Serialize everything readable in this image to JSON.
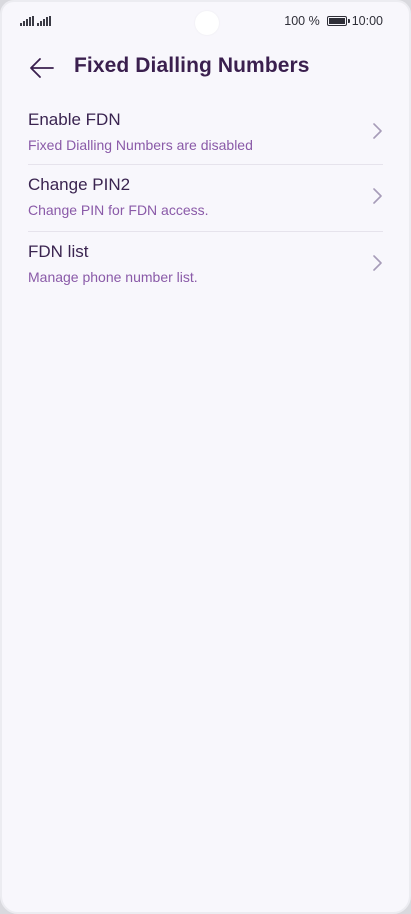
{
  "status_bar": {
    "battery_percent": "100 %",
    "time": "10:00"
  },
  "header": {
    "title": "Fixed Dialling Numbers"
  },
  "items": [
    {
      "title": "Enable FDN",
      "subtitle": "Fixed Dialling Numbers are disabled"
    },
    {
      "title": "Change PIN2",
      "subtitle": "Change PIN for FDN access."
    },
    {
      "title": "FDN list",
      "subtitle": "Manage phone number list."
    }
  ],
  "colors": {
    "title": "#3a1f4e",
    "subtitle": "#8a5aa8",
    "chevron": "#a79cb8",
    "background": "#f8f7fc"
  },
  "icons": {
    "back": "arrow-left-icon",
    "chevron": "chevron-right-icon",
    "signal": "signal-icon",
    "battery": "battery-icon"
  }
}
